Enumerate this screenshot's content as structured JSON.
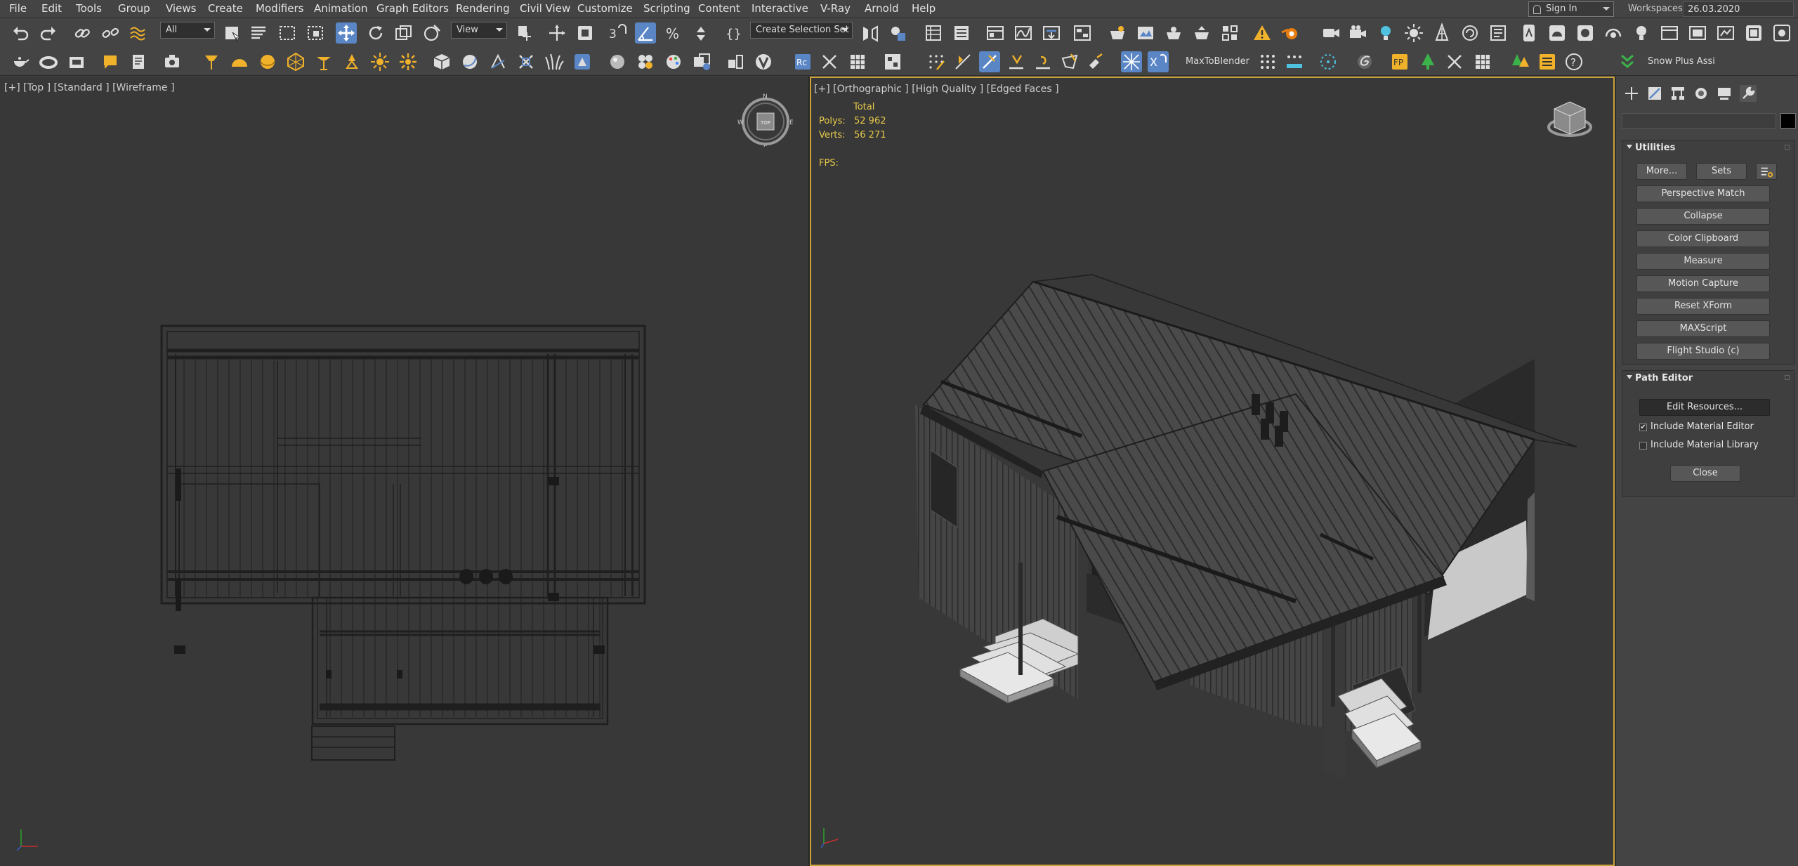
{
  "menu": [
    "File",
    "Edit",
    "Tools",
    "Group",
    "Views",
    "Create",
    "Modifiers",
    "Animation",
    "Graph Editors",
    "Rendering",
    "Civil View",
    "Customize",
    "Scripting",
    "Content",
    "Interactive",
    "V-Ray",
    "Arnold",
    "Help"
  ],
  "account": {
    "sign_in": "Sign In",
    "workspaces_label": "Workspaces:",
    "workspace_value": "26.03.2020"
  },
  "toolbar": {
    "selection_filter": "All",
    "ref_coord": "View",
    "selection_set_placeholder": "Create Selection Set",
    "max_to_blender": "MaxToBlender",
    "snow_plus": "Snow Plus Assi"
  },
  "viewports": {
    "left": {
      "label": "[+] [Top ] [Standard ] [Wireframe ]",
      "viewcube": "TOP"
    },
    "right": {
      "label": "[+] [Orthographic ] [High Quality ] [Edged Faces ]",
      "stats": {
        "header": "Total",
        "polys_label": "Polys:",
        "polys_value": "52 962",
        "verts_label": "Verts:",
        "verts_value": "56 271",
        "fps_label": "FPS:"
      }
    }
  },
  "command_panel": {
    "utilities": {
      "title": "Utilities",
      "more": "More...",
      "sets": "Sets",
      "buttons": [
        "Perspective Match",
        "Collapse",
        "Color Clipboard",
        "Measure",
        "Motion Capture",
        "Reset XForm",
        "MAXScript",
        "Flight Studio (c)"
      ]
    },
    "path_editor": {
      "title": "Path Editor",
      "edit_resources": "Edit Resources...",
      "include_material_editor": "Include Material Editor",
      "include_material_editor_checked": true,
      "include_material_library": "Include Material Library",
      "include_material_library_checked": false,
      "close": "Close"
    }
  },
  "colors": {
    "accent": "#5b86c6",
    "active_viewport_border": "#c9a23a",
    "stats_text": "#e6c84a",
    "icon_yellow": "#f0b12b"
  }
}
